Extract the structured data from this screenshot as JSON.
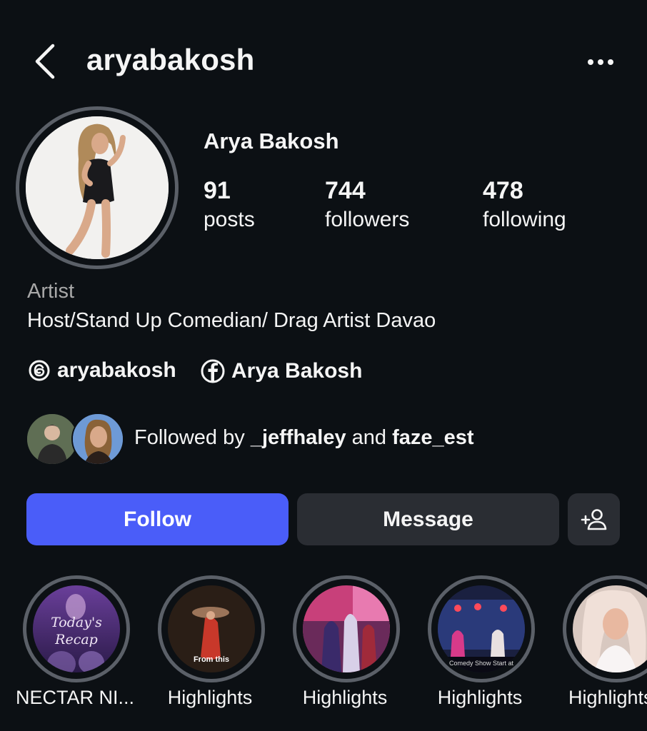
{
  "header": {
    "username": "aryabakosh"
  },
  "profile": {
    "display_name": "Arya Bakosh",
    "stats": [
      {
        "value": "91",
        "label": "posts"
      },
      {
        "value": "744",
        "label": "followers"
      },
      {
        "value": "478",
        "label": "following"
      }
    ],
    "category": "Artist",
    "bio": "Host/Stand Up Comedian/ Drag Artist Davao",
    "links": [
      {
        "icon": "threads-icon",
        "text": "aryabakosh"
      },
      {
        "icon": "facebook-icon",
        "text": "Arya Bakosh"
      }
    ],
    "followed_by": {
      "prefix": "Followed by",
      "user1": "_jeffhaley",
      "joiner": "and",
      "user2": "faze_est"
    }
  },
  "actions": {
    "follow": "Follow",
    "message": "Message"
  },
  "highlights": [
    {
      "label": "NECTAR NI...",
      "cover_text": "Today's Recap"
    },
    {
      "label": "Highlights",
      "cover_text": "From this"
    },
    {
      "label": "Highlights"
    },
    {
      "label": "Highlights",
      "cover_text": "Comedy Show Start at"
    },
    {
      "label": "Highlights"
    }
  ],
  "colors": {
    "background": "#0c1014",
    "follow_button": "#4a5df9",
    "secondary_button": "#2a2d33",
    "ring": "#5b6068"
  }
}
